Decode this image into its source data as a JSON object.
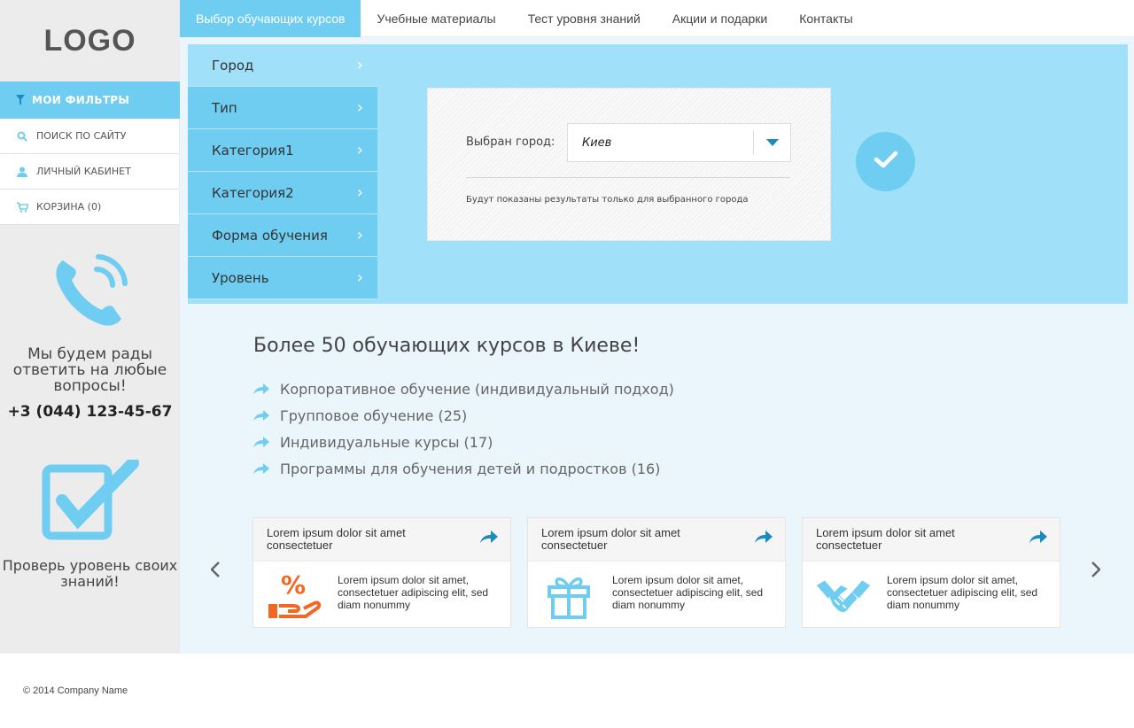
{
  "brand": {
    "logo": "LOGO"
  },
  "nav": {
    "items": [
      {
        "label": "Выбор обучающих курсов",
        "active": true
      },
      {
        "label": "Учебные материалы"
      },
      {
        "label": "Тест уровня знаний"
      },
      {
        "label": "Акции и подарки"
      },
      {
        "label": "Контакты"
      }
    ]
  },
  "sidebar": {
    "filters_label": "МОИ ФИЛЬТРЫ",
    "items": [
      {
        "label": "ПОИСК ПО САЙТУ",
        "icon": "search-icon"
      },
      {
        "label": "ЛИЧНЫЙ КАБИНЕТ",
        "icon": "user-icon"
      },
      {
        "label": "КОРЗИНА (0)",
        "icon": "cart-icon"
      }
    ],
    "contact": {
      "text": "Мы будем рады ответить на любые вопросы!",
      "phone": "+3 (044) 123-45-67"
    },
    "test": {
      "text": "Проверь уровень своих знаний!"
    }
  },
  "filters": {
    "items": [
      "Город",
      "Тип",
      "Категория1",
      "Категория2",
      "Форма обучения",
      "Уровень"
    ]
  },
  "city": {
    "label": "Выбран город:",
    "value": "Киев",
    "note": "Будут показаны результаты только для выбранного города"
  },
  "main": {
    "headline": "Более 50 обучающих курсов в Киеве!",
    "courses": [
      "Корпоративное обучение (индивидуальный подход)",
      "Групповое обучение (25)",
      "Индивидуальные курсы (17)",
      "Программы для обучения детей и подростков (16)"
    ]
  },
  "cards": [
    {
      "title": "Lorem ipsum dolor sit amet consectetuer",
      "text": "Lorem ipsum dolor sit amet, consectetuer adipiscing elit, sed diam nonummy",
      "icon": "percent-hand-icon"
    },
    {
      "title": "Lorem ipsum dolor sit amet consectetuer",
      "text": "Lorem ipsum dolor sit amet, consectetuer adipiscing elit, sed diam nonummy",
      "icon": "gift-icon"
    },
    {
      "title": "Lorem ipsum dolor sit amet consectetuer",
      "text": "Lorem ipsum dolor sit amet, consectetuer adipiscing elit, sed diam nonummy",
      "icon": "handshake-icon"
    }
  ],
  "footer": {
    "copyright": "© 2014 Company Name"
  },
  "colors": {
    "accent": "#6fcdf2",
    "panel": "#a1e0f9",
    "orange": "#f26722"
  }
}
